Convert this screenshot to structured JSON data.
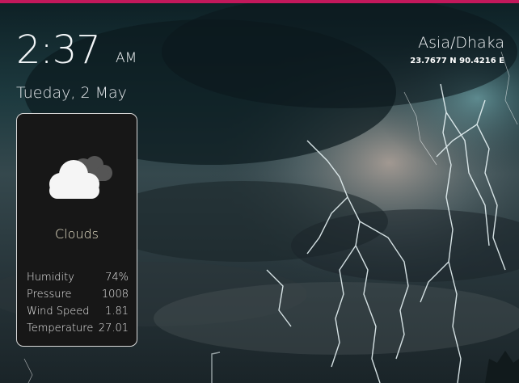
{
  "clock": {
    "time": "2:37",
    "period": "AM"
  },
  "date": "Tueday, 2 May",
  "location": {
    "timezone": "Asia/Dhaka",
    "coordinates": "23.7677 N 90.4216 E"
  },
  "weather": {
    "icon": "clouds-icon",
    "condition": "Clouds",
    "stats": [
      {
        "label": "Humidity",
        "value": "74%"
      },
      {
        "label": "Pressure",
        "value": "1008"
      },
      {
        "label": "Wind Speed",
        "value": "1.81"
      },
      {
        "label": "Temperature",
        "value": "27.01"
      }
    ]
  },
  "colors": {
    "accent_bar": "#c2185b",
    "card_bg": "#171717",
    "card_border": "#d9d9d9"
  }
}
